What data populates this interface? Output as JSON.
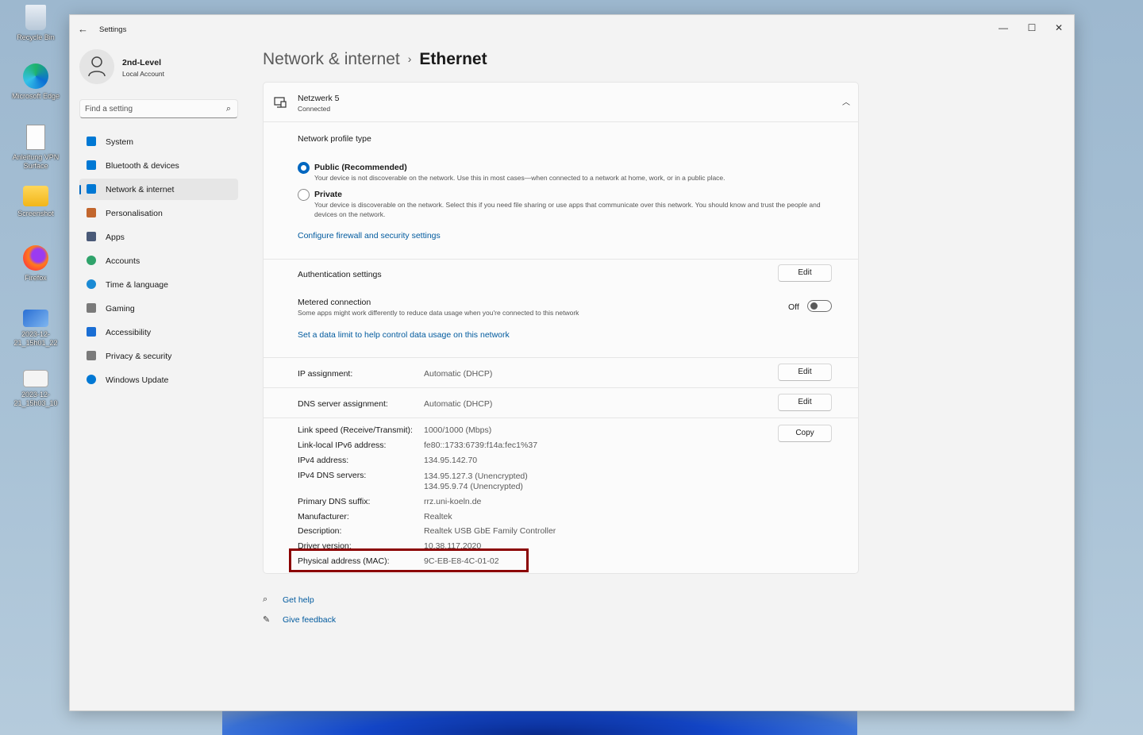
{
  "desktop": {
    "icons": [
      {
        "label": "Recycle Bin",
        "icon": "recycle-bin-icon"
      },
      {
        "label": "Microsoft Edge",
        "icon": "edge-icon"
      },
      {
        "label": "Anleitung VPN Surface",
        "icon": "odt-document-icon"
      },
      {
        "label": "Screenshot",
        "icon": "folder-icon"
      },
      {
        "label": "Firefox",
        "icon": "firefox-icon"
      },
      {
        "label": "2023-12-21_15h01_22",
        "icon": "image-file-icon"
      },
      {
        "label": "2023-12-21_15h03_10",
        "icon": "image-file-icon"
      }
    ]
  },
  "window": {
    "title": "Settings",
    "controls": {
      "minimize": "—",
      "maximize": "☐",
      "close": "✕"
    }
  },
  "user": {
    "name": "2nd-Level",
    "account_type": "Local Account"
  },
  "search": {
    "placeholder": "Find a setting"
  },
  "sidebar": {
    "items": [
      {
        "label": "System",
        "icon": "system-icon",
        "color": "#0078d4"
      },
      {
        "label": "Bluetooth & devices",
        "icon": "bluetooth-icon",
        "color": "#0078d4"
      },
      {
        "label": "Network & internet",
        "icon": "wifi-icon",
        "color": "#0078d4",
        "active": true
      },
      {
        "label": "Personalisation",
        "icon": "brush-icon",
        "color": "#c2662d"
      },
      {
        "label": "Apps",
        "icon": "apps-icon",
        "color": "#4a5a78"
      },
      {
        "label": "Accounts",
        "icon": "accounts-icon",
        "color": "#2fa36b"
      },
      {
        "label": "Time & language",
        "icon": "globe-clock-icon",
        "color": "#1a8ad4"
      },
      {
        "label": "Gaming",
        "icon": "gamepad-icon",
        "color": "#7a7a7a"
      },
      {
        "label": "Accessibility",
        "icon": "accessibility-icon",
        "color": "#1a6ed4"
      },
      {
        "label": "Privacy & security",
        "icon": "shield-icon",
        "color": "#7a7a7a"
      },
      {
        "label": "Windows Update",
        "icon": "update-icon",
        "color": "#0078d4"
      }
    ]
  },
  "header": {
    "parent": "Network & internet",
    "separator": "›",
    "current": "Ethernet"
  },
  "network": {
    "name": "Netzwerk 5",
    "status": "Connected",
    "profile_type_label": "Network profile type",
    "public_label": "Public (Recommended)",
    "public_desc": "Your device is not discoverable on the network. Use this in most cases—when connected to a network at home, work, or in a public place.",
    "private_label": "Private",
    "private_desc": "Your device is discoverable on the network. Select this if you need file sharing or use apps that communicate over this network. You should know and trust the people and devices on the network.",
    "selected_profile": "public",
    "firewall_link": "Configure firewall and security settings",
    "auth_label": "Authentication settings",
    "edit_label": "Edit",
    "metered_label": "Metered connection",
    "metered_desc": "Some apps might work differently to reduce data usage when you're connected to this network",
    "metered_state": "Off",
    "data_limit_link": "Set a data limit to help control data usage on this network",
    "ip_assignment_label": "IP assignment:",
    "ip_assignment_value": "Automatic (DHCP)",
    "dns_assignment_label": "DNS server assignment:",
    "dns_assignment_value": "Automatic (DHCP)",
    "copy_label": "Copy",
    "properties": {
      "link_speed_label": "Link speed (Receive/Transmit):",
      "link_speed_value": "1000/1000 (Mbps)",
      "ipv6_label": "Link-local IPv6 address:",
      "ipv6_value": "fe80::1733:6739:f14a:fec1%37",
      "ipv4_label": "IPv4 address:",
      "ipv4_value": "134.95.142.70",
      "dns_servers_label": "IPv4 DNS servers:",
      "dns_server_1": "134.95.127.3 (Unencrypted)",
      "dns_server_2": "134.95.9.74 (Unencrypted)",
      "dns_suffix_label": "Primary DNS suffix:",
      "dns_suffix_value": "rrz.uni-koeln.de",
      "manufacturer_label": "Manufacturer:",
      "manufacturer_value": "Realtek",
      "description_label": "Description:",
      "description_value": "Realtek USB GbE Family Controller",
      "driver_label": "Driver version:",
      "driver_value": "10.38.117.2020",
      "mac_label": "Physical address (MAC):",
      "mac_value": "9C-EB-E8-4C-01-02"
    }
  },
  "footer": {
    "get_help": "Get help",
    "give_feedback": "Give feedback"
  },
  "colors": {
    "accent": "#0067c0",
    "link": "#005a9e",
    "highlight": "#8b0000"
  }
}
